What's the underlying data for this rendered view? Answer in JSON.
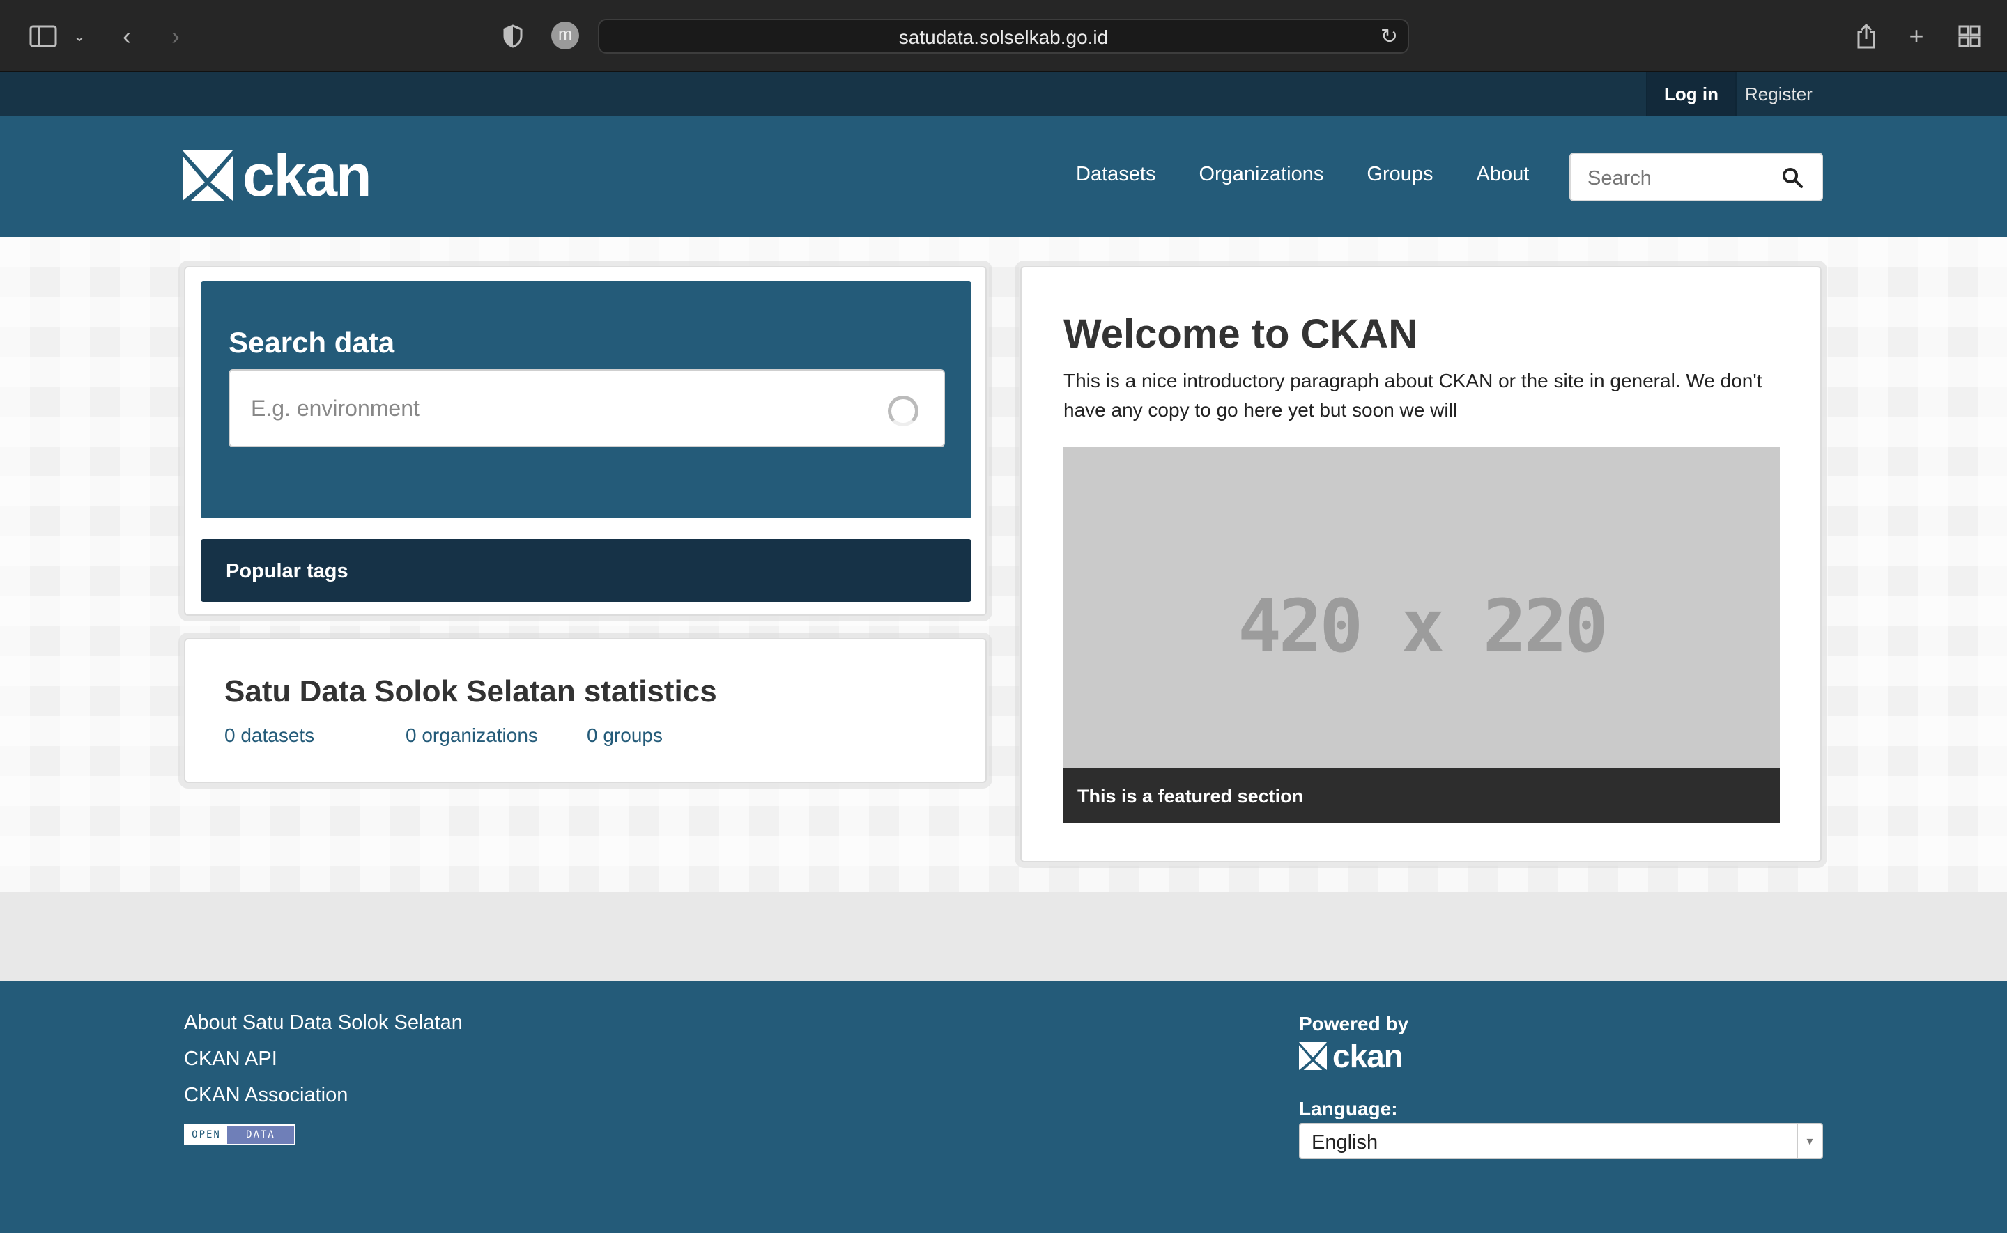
{
  "browser": {
    "url": "satudata.solselkab.go.id",
    "profile_initial": "m"
  },
  "account": {
    "login_label": "Log in",
    "register_label": "Register"
  },
  "header": {
    "logo_text": "ckan",
    "nav": [
      "Datasets",
      "Organizations",
      "Groups",
      "About"
    ],
    "search_placeholder": "Search"
  },
  "search_module": {
    "title": "Search data",
    "placeholder": "E.g. environment",
    "popular_tags_label": "Popular tags"
  },
  "stats": {
    "title": "Satu Data Solok Selatan statistics",
    "items": [
      {
        "count": "0",
        "label": "datasets"
      },
      {
        "count": "0",
        "label": "organizations"
      },
      {
        "count": "0",
        "label": "groups"
      }
    ]
  },
  "welcome": {
    "title": "Welcome to CKAN",
    "text": "This is a nice introductory paragraph about CKAN or the site in general. We don't have any copy to go here yet but soon we will",
    "image_placeholder": "420 x 220",
    "caption": "This is a featured section"
  },
  "footer": {
    "links": [
      "About Satu Data Solok Selatan",
      "CKAN API",
      "CKAN Association"
    ],
    "open_data_badge": {
      "open": "OPEN",
      "data": "DATA"
    },
    "powered_by_label": "Powered by",
    "powered_logo_text": "ckan",
    "language_label": "Language:",
    "language_value": "English"
  },
  "colors": {
    "brand": "#245b79",
    "brand_dark": "#173447",
    "link": "#245b79"
  }
}
